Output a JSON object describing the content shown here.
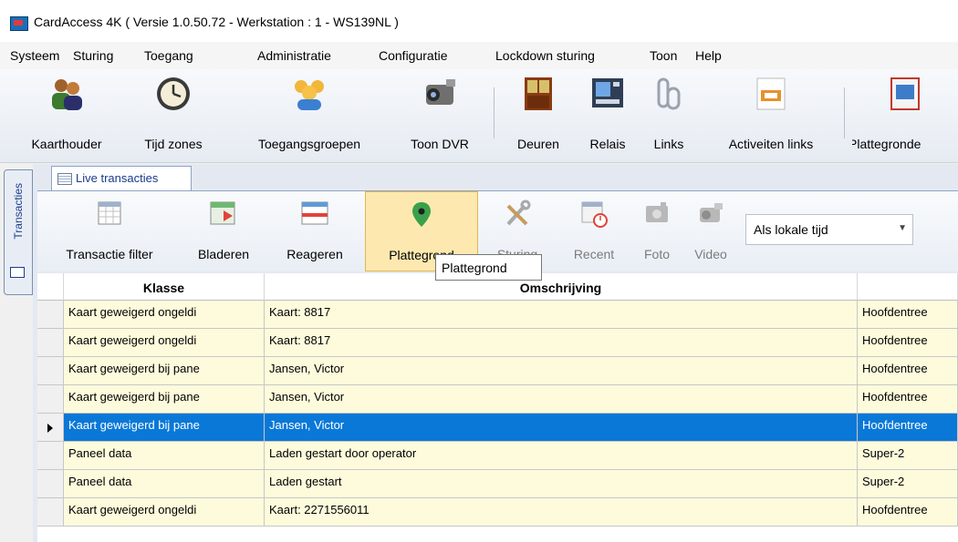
{
  "window": {
    "title": "CardAccess 4K ( Versie 1.0.50.72  -  Werkstation : 1 - WS139NL )"
  },
  "menu": [
    "Systeem",
    "Sturing",
    "Toegang",
    "Administratie",
    "Configuratie",
    "Lockdown sturing",
    "Toon",
    "Help"
  ],
  "ribbon": [
    "Kaarthouder",
    "Tijd zones",
    "Toegangsgroepen",
    "Toon DVR",
    "Deuren",
    "Relais",
    "Links",
    "Activeiten links",
    "Plattegronde"
  ],
  "side_tab": "Transacties",
  "doc_tab": "Live transacties",
  "toolbar": [
    "Transactie filter",
    "Bladeren",
    "Reageren",
    "Plattegrond",
    "Sturing",
    "Recent",
    "Foto",
    "Video"
  ],
  "time_select": "Als lokale tijd",
  "tooltip": "Plattegrond",
  "table": {
    "columns": [
      "Klasse",
      "Omschrijving"
    ],
    "rows": [
      [
        "Kaart geweigerd ongeldi",
        "Kaart: 8817",
        "Hoofdentree"
      ],
      [
        "Kaart geweigerd ongeldi",
        "Kaart: 8817",
        "Hoofdentree"
      ],
      [
        "Kaart geweigerd bij pane",
        "Jansen, Victor",
        "Hoofdentree"
      ],
      [
        "Kaart geweigerd bij pane",
        "Jansen, Victor",
        "Hoofdentree"
      ],
      [
        "Kaart geweigerd bij pane",
        "Jansen, Victor",
        "Hoofdentree"
      ],
      [
        "Paneel data",
        "Laden gestart door operator",
        "Super-2"
      ],
      [
        "Paneel data",
        "Laden gestart",
        "Super-2"
      ],
      [
        "Kaart geweigerd ongeldi",
        "Kaart: 2271556011",
        "Hoofdentree"
      ]
    ],
    "selected_row": 4
  },
  "colors": {
    "row_bg": "#fdfbdc",
    "selected_row_bg": "#0a78d7",
    "active_button_bg": "#fde9b0"
  }
}
